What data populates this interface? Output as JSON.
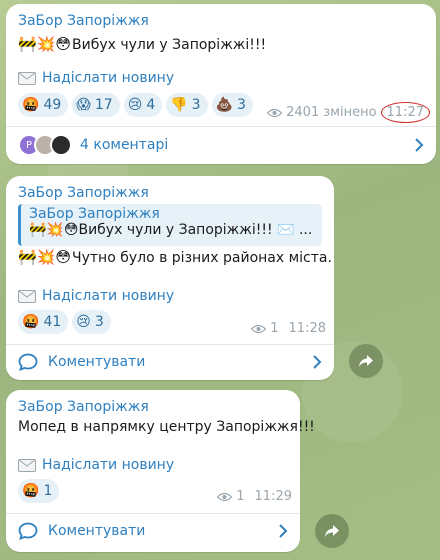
{
  "channel_name": "ЗаБор Запоріжжя",
  "send_news_label": "Надіслати новину",
  "comment_label": "Коментувати",
  "colors": {
    "accent": "#2f80c0",
    "reaction_bg": "#e6f0f7",
    "highlight_ring": "#d12a2a"
  },
  "messages": [
    {
      "sender": "ЗаБор Запоріжжя",
      "emojis": "🚧💥😳",
      "text": "Вибух чули у Запоріжжі!!!",
      "reactions": [
        {
          "emoji": "🤬",
          "count": "49"
        },
        {
          "emoji": "😱",
          "count": "17"
        },
        {
          "emoji": "😢",
          "count": "4"
        },
        {
          "emoji": "👎",
          "count": "3"
        },
        {
          "emoji": "💩",
          "count": "3"
        }
      ],
      "views": "2401",
      "edited": "змінено",
      "time": "11:27",
      "comments": {
        "avatar_letter": "P",
        "label": "4 коментарі"
      }
    },
    {
      "sender": "ЗаБор Запоріжжя",
      "quote": {
        "sender": "ЗаБор Запоріжжя",
        "text": "🚧💥😳Вибух чули у Запоріжжі!!! ✉️ ..."
      },
      "emojis": "🚧💥😳",
      "text": "Чутно було в різних районах міста.",
      "reactions": [
        {
          "emoji": "🤬",
          "count": "41"
        },
        {
          "emoji": "😢",
          "count": "3"
        }
      ],
      "views": "1",
      "time": "11:28"
    },
    {
      "sender": "ЗаБор Запоріжжя",
      "text": "Мопед в напрямку центру Запоріжжя!!!",
      "reactions": [
        {
          "emoji": "🤬",
          "count": "1"
        }
      ],
      "views": "1",
      "time": "11:29"
    }
  ]
}
